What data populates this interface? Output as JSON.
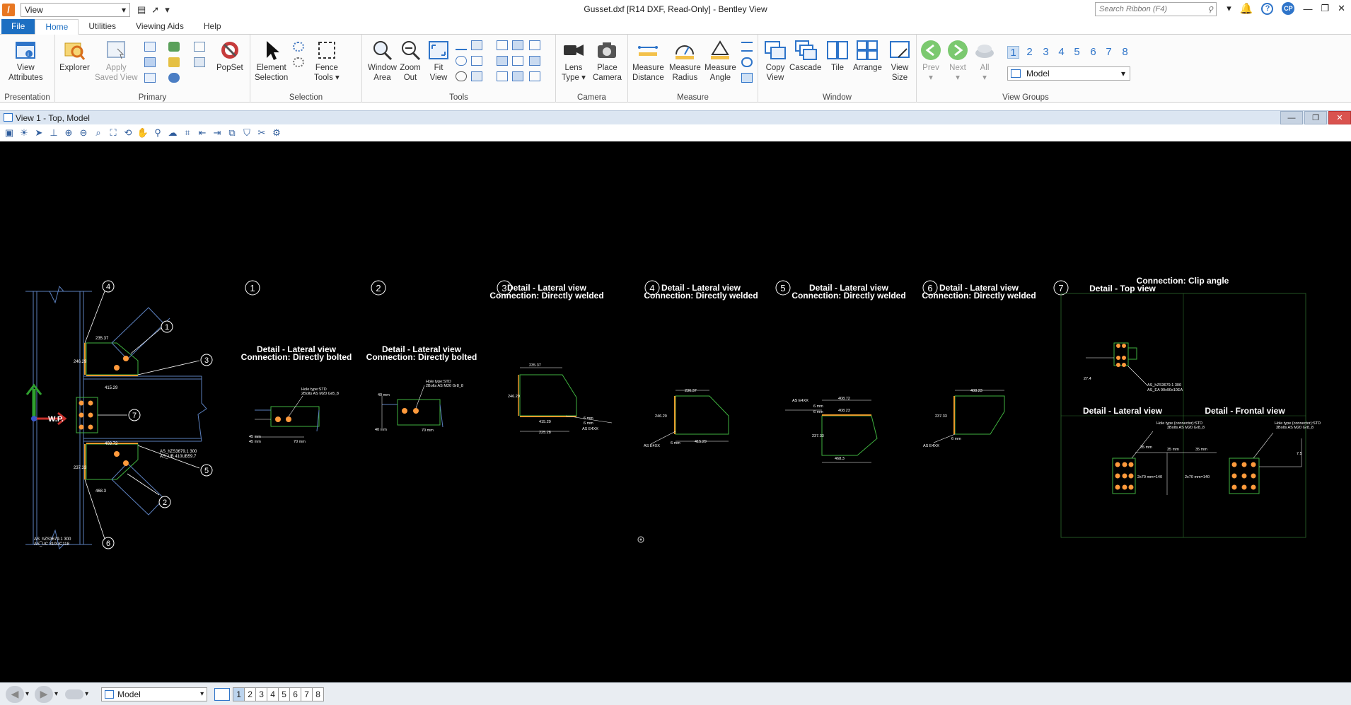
{
  "titlebar": {
    "workflow": "View",
    "title": "Gusset.dxf [R14 DXF, Read-Only] - Bentley View",
    "search_placeholder": "Search Ribbon (F4)",
    "avatar": "CP"
  },
  "tabs": [
    "File",
    "Home",
    "Utilities",
    "Viewing Aids",
    "Help"
  ],
  "ribbon": {
    "groups": {
      "presentation": "Presentation",
      "primary": "Primary",
      "selection": "Selection",
      "tools": "Tools",
      "camera": "Camera",
      "measure": "Measure",
      "window": "Window",
      "view_groups": "View Groups"
    },
    "buttons": {
      "view_attributes": [
        "View",
        "Attributes"
      ],
      "explorer": "Explorer",
      "apply_saved_view": [
        "Apply",
        "Saved View"
      ],
      "popset": "PopSet",
      "element_selection": [
        "Element",
        "Selection"
      ],
      "fence_tools": [
        "Fence",
        "Tools ▾"
      ],
      "window_area": [
        "Window",
        "Area"
      ],
      "zoom_out": [
        "Zoom",
        "Out"
      ],
      "fit_view": [
        "Fit",
        "View"
      ],
      "lens_type": [
        "Lens",
        "Type ▾"
      ],
      "place_camera": [
        "Place",
        "Camera"
      ],
      "measure_distance": [
        "Measure",
        "Distance"
      ],
      "measure_radius": [
        "Measure",
        "Radius"
      ],
      "measure_angle": [
        "Measure",
        "Angle"
      ],
      "copy_view": [
        "Copy",
        "View"
      ],
      "cascade": "Cascade",
      "tile": "Tile",
      "arrange": "Arrange",
      "view_size": [
        "View",
        "Size"
      ],
      "prev": "Prev",
      "next": "Next",
      "all": "All"
    },
    "view_numbers": [
      "1",
      "2",
      "3",
      "4",
      "5",
      "6",
      "7",
      "8"
    ],
    "model_select": "Model"
  },
  "view": {
    "title": "View 1 - Top, Model"
  },
  "drawing": {
    "callouts": [
      "1",
      "2",
      "3",
      "4",
      "5",
      "6",
      "7"
    ],
    "detail_lateral": "Detail - Lateral view",
    "directly_bolted": "Connection: Directly bolted",
    "directly_welded": "Connection: Directly welded",
    "clip_angle": "Connection: Clip angle",
    "top_view": "Detail - Top view",
    "frontal_view": "Detail - Frontal view",
    "wp": "W.P.",
    "main_labels": [
      "AS_hZS3679.1 300",
      "AS_UC 310UC118",
      "AS_hZS3679.1 300",
      "AS_UB 410UB59.7"
    ],
    "dims_main": [
      "235.37",
      "246.29",
      "415.29",
      "408.72",
      "237.33",
      "468.3"
    ],
    "bolt_note_1": [
      "Hole type:STD",
      "2Bolts AS M20 Gr8_8"
    ],
    "bolt_note_2": [
      "Hole type:STD",
      "2Bolts AS M20 Gr8_8"
    ],
    "d1_dims": [
      "45 mm",
      "45 mm",
      "70 mm"
    ],
    "d2_dims": [
      "40 mm",
      "40 mm",
      "70 mm"
    ],
    "d3_dims": [
      "235.37",
      "246.29",
      "415.29",
      "6 mm",
      "6 mm",
      "AS E4XX",
      "225.28"
    ],
    "d4_dims": [
      "236.37",
      "246.29",
      "415.29",
      "6 mm",
      "AS E4XX"
    ],
    "d5_dims": [
      "408.72",
      "408.23",
      "6 mm",
      "6 mm",
      "AS E4XX",
      "237.33",
      "468.3"
    ],
    "d6_dims": [
      "408.23",
      "237.33",
      "6 mm",
      "AS E4XX"
    ],
    "d7_top_labels": [
      "AS_hZS3679.1 300",
      "AS_EA 90x90x10EA",
      "27.4"
    ],
    "d7_notes": [
      "Hole type (connector):STD",
      "3Bolts AS M20 Gr8_8",
      "Hole type (connector):STD",
      "3Bolts AS M20 Gr8_8"
    ],
    "d7_dims": [
      "35 mm",
      "35 mm",
      "35 mm",
      "2x70 mm=140",
      "2x70 mm=140",
      "7.5"
    ]
  },
  "statusbar": {
    "model": "Model",
    "view_numbers": [
      "1",
      "2",
      "3",
      "4",
      "5",
      "6",
      "7",
      "8"
    ]
  },
  "colors": {
    "accent": "#1d6fc2",
    "canvas": "#000000",
    "plate": "#3fb23f",
    "steel": "#5b7fbd",
    "weld": "#e89a2c",
    "bolt": "#ff9a3c",
    "annotation": "#ffffff"
  }
}
